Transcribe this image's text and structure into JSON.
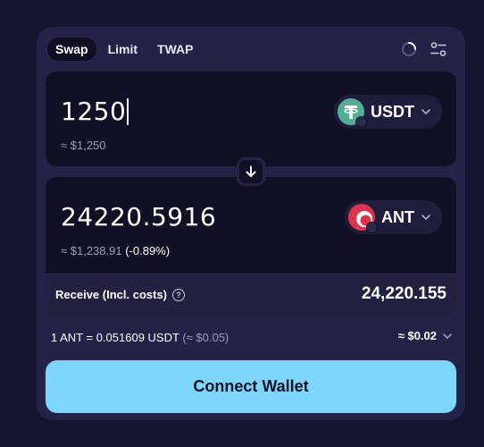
{
  "tabs": [
    {
      "label": "Swap",
      "active": true
    },
    {
      "label": "Limit",
      "active": false
    },
    {
      "label": "TWAP",
      "active": false
    }
  ],
  "icons": {
    "refresh": "refresh-spinner-icon",
    "settings": "settings-sliders-icon",
    "switch": "arrow-down-icon",
    "chevron": "chevron-down-icon",
    "help": "question-circle-icon"
  },
  "sell": {
    "amount": "1250",
    "usd_value": "≈ $1,250",
    "token": {
      "symbol": "USDT",
      "color": "#50af95"
    }
  },
  "buy": {
    "amount": "24220.5916",
    "usd_value": "≈ $1,238.91",
    "price_impact": "(-0.89%)",
    "token": {
      "symbol": "ANT",
      "color": "#e0324b"
    }
  },
  "receive": {
    "label": "Receive (Incl. costs)",
    "value": "24,220.155"
  },
  "rate": {
    "text": "1 ANT = 0.051609 USDT",
    "usd": "(≈ $0.05)"
  },
  "fee": {
    "value": "≈ $0.02"
  },
  "connect_button": {
    "label": "Connect Wallet",
    "color": "#7dd6fb"
  },
  "help_glyph": "?"
}
